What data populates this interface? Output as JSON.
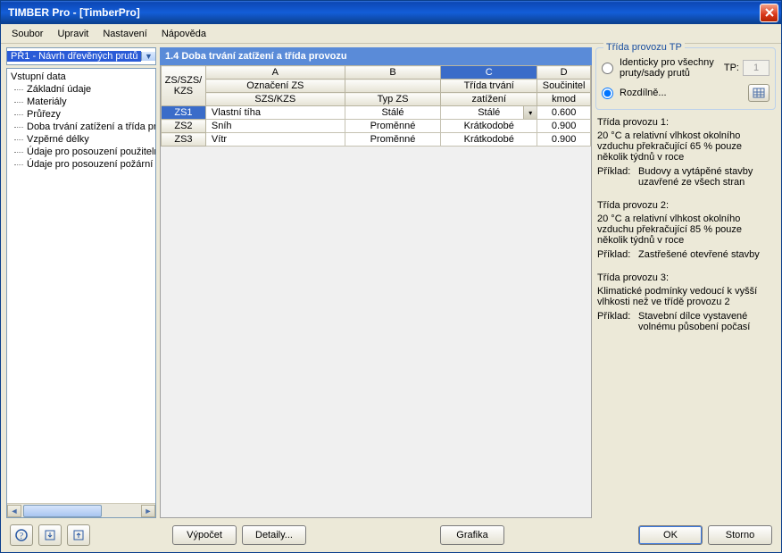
{
  "window": {
    "title": "TIMBER Pro - [TimberPro]"
  },
  "menu": [
    "Soubor",
    "Upravit",
    "Nastavení",
    "Nápověda"
  ],
  "left": {
    "combo": "PŘ1 - Návrh dřevěných prutů",
    "root": "Vstupní data",
    "nodes": [
      "Základní údaje",
      "Materiály",
      "Průřezy",
      "Doba trvání zatížení a třída provozu",
      "Vzpěrné délky",
      "Údaje pro posouzení použitelnosti",
      "Údaje pro posouzení požární odolnosti"
    ]
  },
  "section": {
    "title": "1.4 Doba trvání zatížení a třída provozu"
  },
  "grid": {
    "letters": [
      "A",
      "B",
      "C",
      "D"
    ],
    "selectedLetter": "C",
    "rowhdr": "ZS/SZS/\nKZS",
    "headers1": [
      "Označení ZS",
      "",
      "Třída trvání",
      "Součinitel"
    ],
    "headers2": [
      "SZS/KZS",
      "Typ ZS",
      "zatížení",
      "kmod"
    ],
    "rows": [
      {
        "id": "ZS1",
        "sel": true,
        "a": "Vlastní tíha",
        "b": "Stálé",
        "c": "Stálé",
        "c_dd": true,
        "d": "0.600"
      },
      {
        "id": "ZS2",
        "sel": false,
        "a": "Sníh",
        "b": "Proměnné",
        "c": "Krátkodobé",
        "c_dd": false,
        "d": "0.900"
      },
      {
        "id": "ZS3",
        "sel": false,
        "a": "Vítr",
        "b": "Proměnné",
        "c": "Krátkodobé",
        "c_dd": false,
        "d": "0.900"
      }
    ]
  },
  "right": {
    "group_title": "Třída provozu TP",
    "radio1": "Identicky pro všechny pruty/sady prutů",
    "tp_label": "TP:",
    "tp_value": "1",
    "radio2": "Rozdílně...",
    "info": [
      {
        "title": "Třída provozu 1:",
        "desc": "20 °C a relativní vlhkost okolního vzduchu překračující 65 % pouze několik týdnů v roce",
        "ex": "Budovy a vytápěné stavby uzavřené ze všech stran"
      },
      {
        "title": "Třída provozu 2:",
        "desc": "20 °C a relativní vlhkost okolního vzduchu překračující 85 % pouze několik týdnů v roce",
        "ex": "Zastřešené otevřené stavby"
      },
      {
        "title": "Třída provozu 3:",
        "desc": "Klimatické podmínky vedoucí k vyšší vlhkosti než ve třídě provozu 2",
        "ex": "Stavební dílce vystavené volnému působení počasí"
      }
    ],
    "ex_label": "Příklad:"
  },
  "buttons": {
    "calc": "Výpočet",
    "details": "Detaily...",
    "graphics": "Grafika",
    "ok": "OK",
    "cancel": "Storno"
  }
}
